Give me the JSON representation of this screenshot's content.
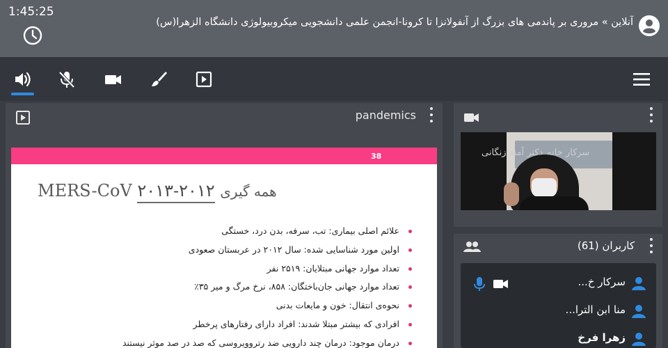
{
  "header": {
    "elapsed_time": "1:45:25",
    "room_title": "آنلاین » مروری بر پاندمی های بزرگ از آنفولانزا تا کرونا-انجمن علمی دانشجویی میکروبیولوژی دانشگاه الزهرا(س)"
  },
  "toolbar": {
    "buttons": [
      "speaker-icon",
      "mic-off-icon",
      "camera-icon",
      "brush-icon",
      "presentation-icon",
      "menu-icon"
    ],
    "active_color": "#2f8be0"
  },
  "presentation": {
    "name": "pandemics",
    "slide": {
      "number": "38",
      "accent_color": "#f83d84",
      "title_latin": "MERS-CoV",
      "title_persian": "همه گیری",
      "title_years": "۲۰۱۲-۲۰۱۳",
      "bullets": [
        "علائم اصلی بیماری: تب، سرفه، بدن درد، خستگی",
        "اولین مورد شناسایی شده: سال ۲۰۱۲ در عربستان صعودی",
        "تعداد موارد جهانی مبتلایان: ۲۵۱۹ نفر",
        "تعداد موارد جهانی جان‌باختگان: ۸۵۸، نرخ مرگ و میر  ۳۵٪",
        "نحوه‌ی انتقال: خون و مایعات بدنی",
        "افرادی که بیشتر مبتلا شدند: افراد دارای رفتارهای پرخطر",
        "درمان موجود: درمان چند دارویی ضد رتروویروسی که صد در صد موثر نیستند"
      ]
    }
  },
  "webcam": {
    "overlay_text": "سرکار خانم دکتر آمنه زنگانی"
  },
  "users": {
    "title": "کاربران (61)",
    "list": [
      {
        "name": "سرکار خ...",
        "bold": false
      },
      {
        "name": "منا ابن الترا...",
        "bold": false
      },
      {
        "name": "زهرا فرخ",
        "bold": true
      }
    ],
    "icon_color": "#2f8be0"
  }
}
